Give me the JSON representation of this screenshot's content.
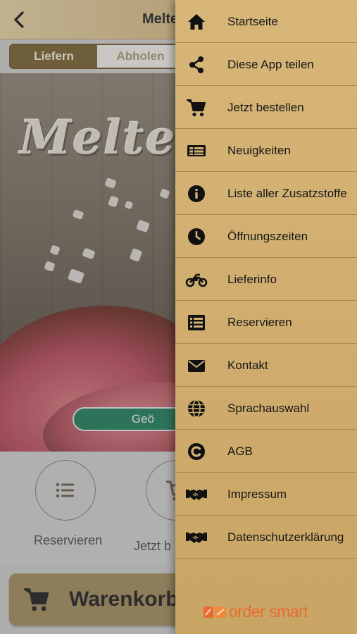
{
  "app": {
    "title": "Melte",
    "tabs": {
      "deliver": "Liefern",
      "pickup": "Abholen"
    },
    "hero_logo": "Melte",
    "open_status": "Geö",
    "actions": [
      {
        "label": "Reservieren",
        "icon": "list-icon"
      },
      {
        "label": "Jetzt b",
        "icon": "cart-icon"
      }
    ],
    "cart_label": "Warenkorb"
  },
  "drawer": {
    "items": [
      {
        "label": "Startseite",
        "icon": "home-icon"
      },
      {
        "label": "Diese App teilen",
        "icon": "share-icon"
      },
      {
        "label": "Jetzt bestellen",
        "icon": "cart-icon"
      },
      {
        "label": "Neuigkeiten",
        "icon": "news-icon"
      },
      {
        "label": "Liste aller Zusatzstoffe",
        "icon": "info-icon"
      },
      {
        "label": "Öffnungszeiten",
        "icon": "clock-icon"
      },
      {
        "label": "Lieferinfo",
        "icon": "motorcycle-icon"
      },
      {
        "label": "Reservieren",
        "icon": "list-icon"
      },
      {
        "label": "Kontakt",
        "icon": "envelope-icon"
      },
      {
        "label": "Sprachauswahl",
        "icon": "globe-icon"
      },
      {
        "label": "AGB",
        "icon": "copyright-icon"
      },
      {
        "label": "Impressum",
        "icon": "handshake-icon"
      },
      {
        "label": "Datenschutzerklärung",
        "icon": "handshake-icon"
      }
    ],
    "brand": "order smart"
  },
  "colors": {
    "drawer_bg": "#d3b272",
    "active_tab": "#76602f",
    "open_badge": "#1d7d5a",
    "brand_orange": "#e86a2e"
  }
}
